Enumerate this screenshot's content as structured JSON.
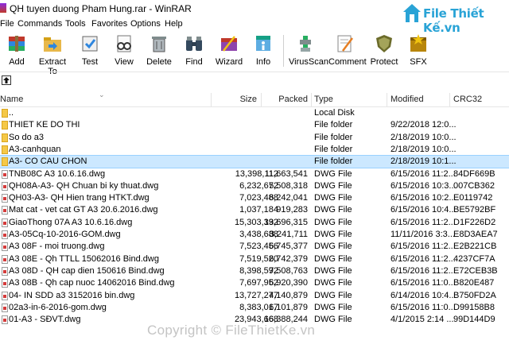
{
  "window": {
    "title": "QH tuyen duong Pham Hung.rar - WinRAR"
  },
  "brand": {
    "name": "File Thiết Kế.vn"
  },
  "menu": [
    "File",
    "Commands",
    "Tools",
    "Favorites",
    "Options",
    "Help"
  ],
  "toolbar": [
    {
      "label": "Add",
      "icon": "add-archive-icon",
      "color": "#c0392b"
    },
    {
      "label": "Extract To",
      "icon": "extract-folder-icon",
      "color": "#d4a017"
    },
    {
      "label": "Test",
      "icon": "test-archive-icon",
      "color": "#2e86de"
    },
    {
      "label": "View",
      "icon": "view-glasses-icon",
      "color": "#555555"
    },
    {
      "label": "Delete",
      "icon": "delete-icon",
      "color": "#7f8c8d"
    },
    {
      "label": "Find",
      "icon": "find-binoculars-icon",
      "color": "#34495e"
    },
    {
      "label": "Wizard",
      "icon": "wizard-icon",
      "color": "#8e44ad"
    },
    {
      "label": "Info",
      "icon": "info-icon",
      "color": "#16a085"
    },
    {
      "label": "VirusScan",
      "icon": "virus-scan-icon",
      "color": "#27ae60"
    },
    {
      "label": "Comment",
      "icon": "comment-icon",
      "color": "#e67e22"
    },
    {
      "label": "Protect",
      "icon": "protect-shield-icon",
      "color": "#6b6b2a"
    },
    {
      "label": "SFX",
      "icon": "sfx-icon",
      "color": "#b8860b"
    }
  ],
  "columns": {
    "name": "Name",
    "size": "Size",
    "packed": "Packed",
    "type": "Type",
    "modified": "Modified",
    "crc": "CRC32"
  },
  "files": [
    {
      "name": "..",
      "size": "",
      "packed": "",
      "type": "Local Disk",
      "modified": "",
      "crc": "",
      "kind": "parent"
    },
    {
      "name": "THIET KE DO THI",
      "size": "",
      "packed": "",
      "type": "File folder",
      "modified": "9/22/2018 12:0...",
      "crc": "",
      "kind": "folder"
    },
    {
      "name": "So do a3",
      "size": "",
      "packed": "",
      "type": "File folder",
      "modified": "2/18/2019 10:0...",
      "crc": "",
      "kind": "folder"
    },
    {
      "name": "A3-canhquan",
      "size": "",
      "packed": "",
      "type": "File folder",
      "modified": "2/18/2019 10:0...",
      "crc": "",
      "kind": "folder"
    },
    {
      "name": "A3- CO CAU CHON",
      "size": "",
      "packed": "",
      "type": "File folder",
      "modified": "2/18/2019 10:1...",
      "crc": "",
      "kind": "folder",
      "selected": true
    },
    {
      "name": "TNB08C A3 10.6.16.dwg",
      "size": "13,398,112",
      "packed": "11,663,541",
      "type": "DWG File",
      "modified": "6/15/2016 11:2...",
      "crc": "84DF669B",
      "kind": "dwg"
    },
    {
      "name": "QH08A-A3- QH Chuan bi ky thuat.dwg",
      "size": "6,232,672",
      "packed": "5,508,318",
      "type": "DWG File",
      "modified": "6/15/2016 10:3...",
      "crc": "007CB362",
      "kind": "dwg"
    },
    {
      "name": "QH03-A3- QH Hien trang HTKT.dwg",
      "size": "7,023,488",
      "packed": "6,242,041",
      "type": "DWG File",
      "modified": "6/15/2016 10:2...",
      "crc": "E0119742",
      "kind": "dwg"
    },
    {
      "name": "Mat cat - vet cat GT A3 20.6.2016.dwg",
      "size": "1,037,184",
      "packed": "919,283",
      "type": "DWG File",
      "modified": "6/15/2016 10:4...",
      "crc": "BE5792BF",
      "kind": "dwg"
    },
    {
      "name": "GiaoThong 07A A3 10.6.16.dwg",
      "size": "15,303,392",
      "packed": "13,696,315",
      "type": "DWG File",
      "modified": "6/15/2016 11:2...",
      "crc": "D1F226D2",
      "kind": "dwg"
    },
    {
      "name": "A3-05Cq-10-2016-GOM.dwg",
      "size": "3,438,688",
      "packed": "3,241,711",
      "type": "DWG File",
      "modified": "11/11/2016 3:3...",
      "crc": "E8D3AEA7",
      "kind": "dwg"
    },
    {
      "name": "A3 08F - moi truong.dwg",
      "size": "7,523,456",
      "packed": "6,745,377",
      "type": "DWG File",
      "modified": "6/15/2016 11:2...",
      "crc": "E2B221CB",
      "kind": "dwg"
    },
    {
      "name": "A3 08E - Qh TTLL 15062016 Bind.dwg",
      "size": "7,519,520",
      "packed": "6,742,379",
      "type": "DWG File",
      "modified": "6/15/2016 11:2...",
      "crc": "4237CF7A",
      "kind": "dwg"
    },
    {
      "name": "A3 08D - QH cap dien 150616 Bind.dwg",
      "size": "8,398,592",
      "packed": "7,508,763",
      "type": "DWG File",
      "modified": "6/15/2016 11:2...",
      "crc": "E72CEB3B",
      "kind": "dwg"
    },
    {
      "name": "A3 08B - Qh cap nuoc 14062016 Bind.dwg",
      "size": "7,697,952",
      "packed": "6,920,390",
      "type": "DWG File",
      "modified": "6/15/2016 11:0...",
      "crc": "B820E487",
      "kind": "dwg"
    },
    {
      "name": "04- IN SDD a3 3152016 bin.dwg",
      "size": "13,727,277",
      "packed": "4,140,879",
      "type": "DWG File",
      "modified": "6/14/2016 10:4...",
      "crc": "B750FD2A",
      "kind": "dwg"
    },
    {
      "name": "02a3-in-6-2016-gom.dwg",
      "size": "8,383,017",
      "packed": "6,101,879",
      "type": "DWG File",
      "modified": "6/15/2016 11:0...",
      "crc": "D99158B8",
      "kind": "dwg"
    },
    {
      "name": "01-A3 - SĐVT.dwg",
      "size": "23,943,668",
      "packed": "16,388,244",
      "type": "DWG File",
      "modified": "4/1/2015 2:14 ...",
      "crc": "99D144D9",
      "kind": "dwg"
    }
  ],
  "watermark": "Copyright © FileThietKe.vn",
  "colors": {
    "selection": "#cce8ff",
    "folder": "#f5c847",
    "brand": "#29a3d6"
  }
}
